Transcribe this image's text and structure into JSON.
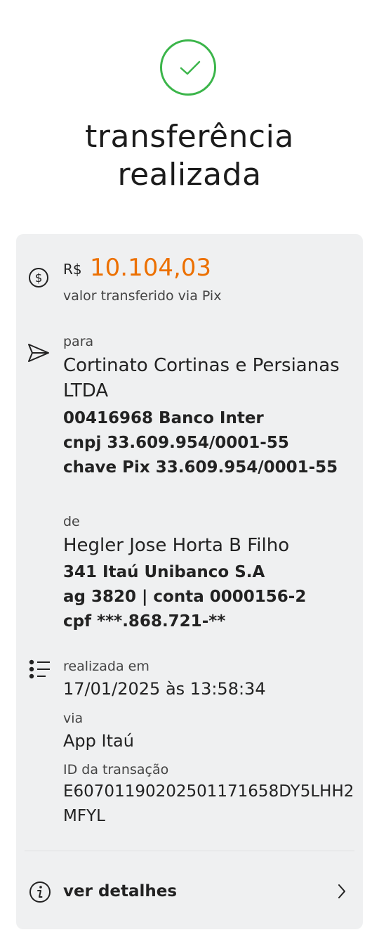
{
  "header": {
    "title_line1": "transferência",
    "title_line2": "realizada"
  },
  "amount": {
    "currency": "R$",
    "value": "10.104,03",
    "caption": "valor transferido via Pix"
  },
  "recipient": {
    "label": "para",
    "name_line1": "Cortinato Cortinas e Persianas",
    "name_line2": "LTDA",
    "bank": "00416968 Banco Inter",
    "document": "cnpj 33.609.954/0001-55",
    "pix_key": "chave Pix 33.609.954/0001-55"
  },
  "sender": {
    "label": "de",
    "name": "Hegler Jose Horta B Filho",
    "bank": "341 Itaú Unibanco S.A",
    "account": "ag 3820 | conta 0000156-2",
    "document": "cpf ***.868.721-**"
  },
  "details": {
    "date_label": "realizada em",
    "date_value": "17/01/2025 às 13:58:34",
    "via_label": "via",
    "via_value": "App Itaú",
    "id_label": "ID da transação",
    "id_line1": "E60701190202501171658DY5LHH2",
    "id_line2": "MFYL"
  },
  "footer": {
    "details_link": "ver detalhes"
  },
  "colors": {
    "success": "#3bb54a",
    "accent": "#ec7000",
    "card_bg": "#eff0f1"
  }
}
